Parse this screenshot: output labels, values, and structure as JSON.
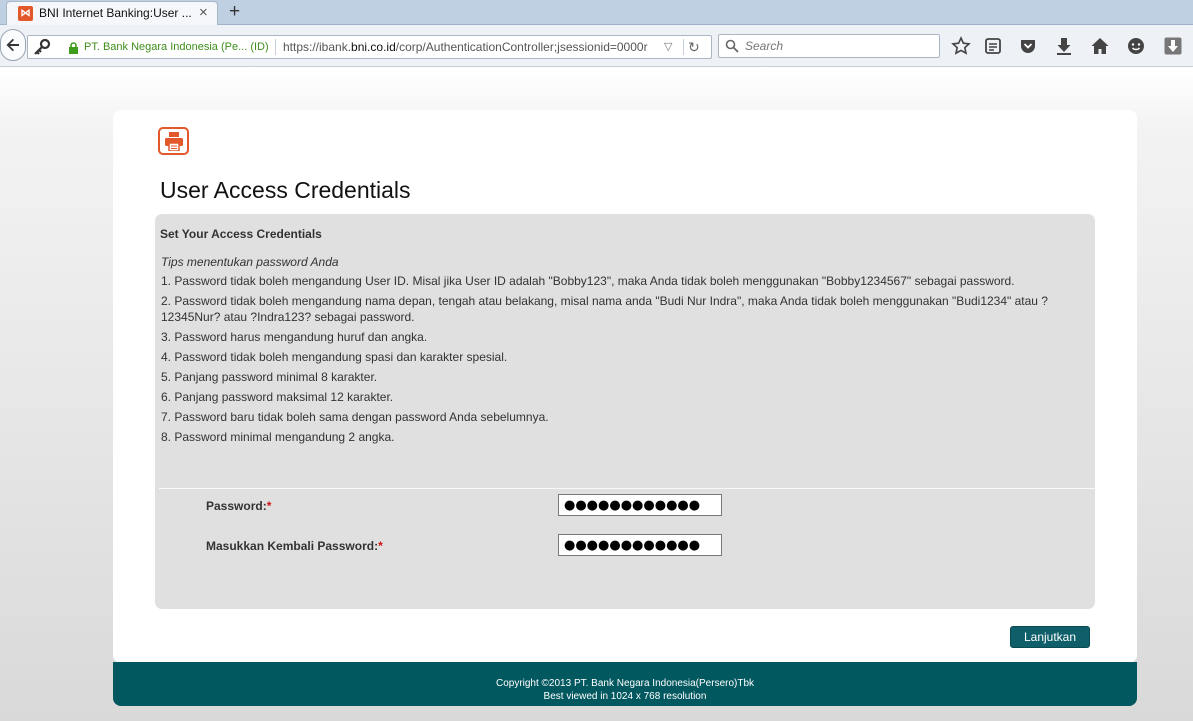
{
  "browser": {
    "tab_title": "BNI Internet Banking:User ...",
    "tab_close": "×",
    "new_tab": "+",
    "identity": "PT. Bank Negara Indonesia (Pe...  (ID)",
    "url_prefix": "https://ibank.",
    "url_domain": "bni.co.id",
    "url_suffix": "/corp/AuthenticationController;jsessionid=0000r",
    "search_placeholder": "Search",
    "toolbar_icons": [
      "star-icon",
      "reading-list-icon",
      "pocket-icon",
      "download-icon",
      "home-icon",
      "chat-icon",
      "menu-download-icon"
    ]
  },
  "page": {
    "title": "User Access Credentials",
    "panel_heading": "Set Your Access Credentials",
    "tips_title": "Tips menentukan password Anda",
    "tips": [
      "1. Password tidak boleh mengandung User ID. Misal jika User ID adalah \"Bobby123\", maka Anda tidak boleh menggunakan \"Bobby1234567\" sebagai password.",
      "2. Password tidak boleh mengandung nama depan, tengah atau belakang, misal nama anda \"Budi Nur Indra\", maka Anda tidak boleh menggunakan \"Budi1234\" atau ?12345Nur? atau ?Indra123? sebagai password.",
      "3. Password harus mengandung huruf dan angka.",
      "4. Password tidak boleh mengandung spasi dan karakter spesial.",
      "5. Panjang password minimal 8 karakter.",
      "6. Panjang password maksimal 12 karakter.",
      "7. Password baru tidak boleh sama dengan password Anda sebelumnya.",
      "8. Password minimal mengandung 2 angka."
    ],
    "password_label": "Password:",
    "password_value": "●●●●●●●●●●●●",
    "confirm_label": "Masukkan Kembali Password:",
    "confirm_value": "●●●●●●●●●●●●",
    "required_mark": "*",
    "submit_label": "Lanjutkan"
  },
  "footer": {
    "copyright": "Copyright ©2013 PT. Bank Negara Indonesia(Persero)Tbk",
    "resolution_note": "Best viewed in 1024 x 768 resolution"
  },
  "colors": {
    "accent_teal": "#02585f",
    "brand_orange": "#e2582b",
    "panel_gray": "#e0e0e0"
  }
}
